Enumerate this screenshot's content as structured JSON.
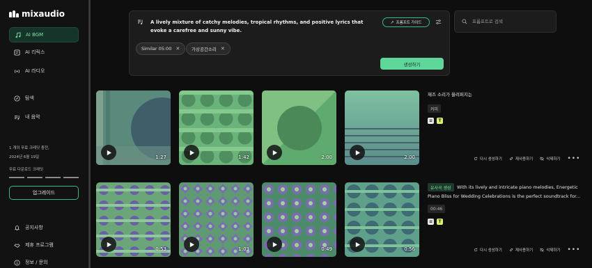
{
  "brand": {
    "name": "mixaudio"
  },
  "sidebar": {
    "nav": [
      {
        "label": "AI BGM",
        "icon": "music-note-icon",
        "active": true
      },
      {
        "label": "AI 리릭스",
        "icon": "lyrics-icon",
        "active": false
      },
      {
        "label": "AI 라디오",
        "icon": "radio-icon",
        "active": false
      },
      {
        "label": "탐색",
        "icon": "compass-icon",
        "active": false
      },
      {
        "label": "내 음악",
        "icon": "my-music-icon",
        "active": false
      }
    ],
    "credits_line1": "1 개의 무료 크레딧 충전,",
    "credits_line2": "2024년 6월 19일",
    "download_credits_label": "무료 다운로드 크레딧",
    "upgrade_label": "업그레이드",
    "bottom": [
      {
        "label": "공지사항",
        "icon": "bell-icon"
      },
      {
        "label": "제휴 프로그램",
        "icon": "handshake-icon"
      },
      {
        "label": "정보 / 문의",
        "icon": "info-icon"
      }
    ]
  },
  "prompt": {
    "text": "A lively mixture of catchy melodies, tropical rhythms, and positive lyrics that evoke a carefree and sunny vibe.",
    "guide_label": "프롬프트 가이드",
    "chips": [
      "Similar 05:00",
      "가상공간소리"
    ],
    "generate_label": "생성하기"
  },
  "search": {
    "placeholder": "프롬프트로 검색"
  },
  "rows": [
    {
      "durations": [
        "1:27",
        "1:42",
        "2:00",
        "2:00"
      ],
      "title": "재즈 소리가 울려퍼지는",
      "tag": "커피",
      "actions": [
        "다시 생성하기",
        "재사용하기",
        "삭제하기"
      ]
    },
    {
      "durations": [
        "0:53",
        "1:03",
        "0:49",
        "0:56"
      ],
      "badge": "유사곡 생성",
      "title": "With its lively and intricate piano melodies, Energetic",
      "title2": "Piano Bliss for Wedding Celebrations is the perfect soundtrack for...",
      "tag": "00:46",
      "actions": [
        "다시 생성하기",
        "재사용하기",
        "삭제하기"
      ]
    }
  ],
  "colors": {
    "accent": "#5fd69a",
    "background": "#0e0e0e",
    "panel": "#1c1c1c"
  }
}
